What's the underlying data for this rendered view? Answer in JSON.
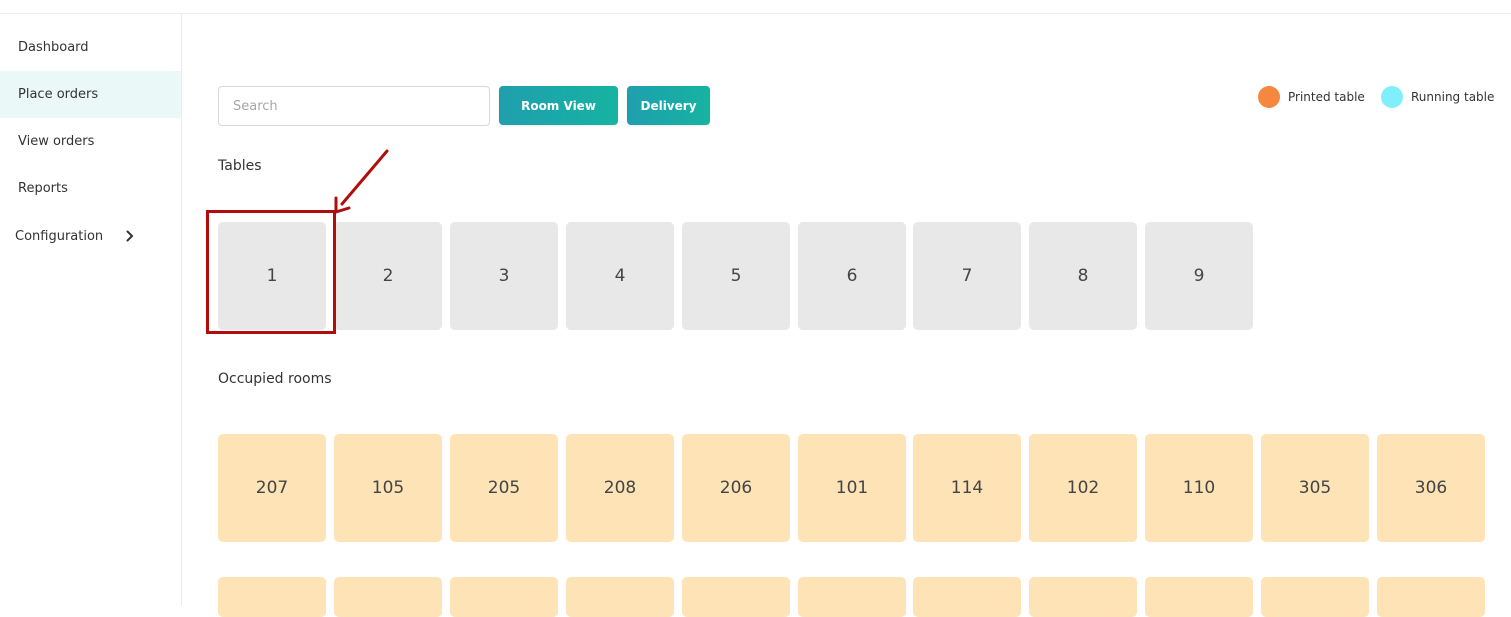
{
  "sidebar": {
    "items": [
      {
        "label": "Dashboard"
      },
      {
        "label": "Place orders"
      },
      {
        "label": "View orders"
      },
      {
        "label": "Reports"
      },
      {
        "label": "Configuration"
      }
    ]
  },
  "search": {
    "placeholder": "Search",
    "value": ""
  },
  "buttons": {
    "room_view": "Room View",
    "delivery": "Delivery"
  },
  "legend": {
    "printed": {
      "label": "Printed table",
      "color": "#f5883e"
    },
    "running": {
      "label": "Running table",
      "color": "#7ff0fb"
    }
  },
  "tables": {
    "title": "Tables",
    "items": [
      "1",
      "2",
      "3",
      "4",
      "5",
      "6",
      "7",
      "8",
      "9"
    ]
  },
  "rooms": {
    "title": "Occupied rooms",
    "items": [
      "207",
      "105",
      "205",
      "208",
      "206",
      "101",
      "114",
      "102",
      "110",
      "305",
      "306"
    ]
  },
  "colors": {
    "accent_start": "#1f9fae",
    "accent_end": "#16b3a1",
    "table_tile": "#e8e8e8",
    "room_tile": "#fde3b6",
    "active_nav": "#eaf8f7",
    "annotation": "#b00d0d"
  }
}
